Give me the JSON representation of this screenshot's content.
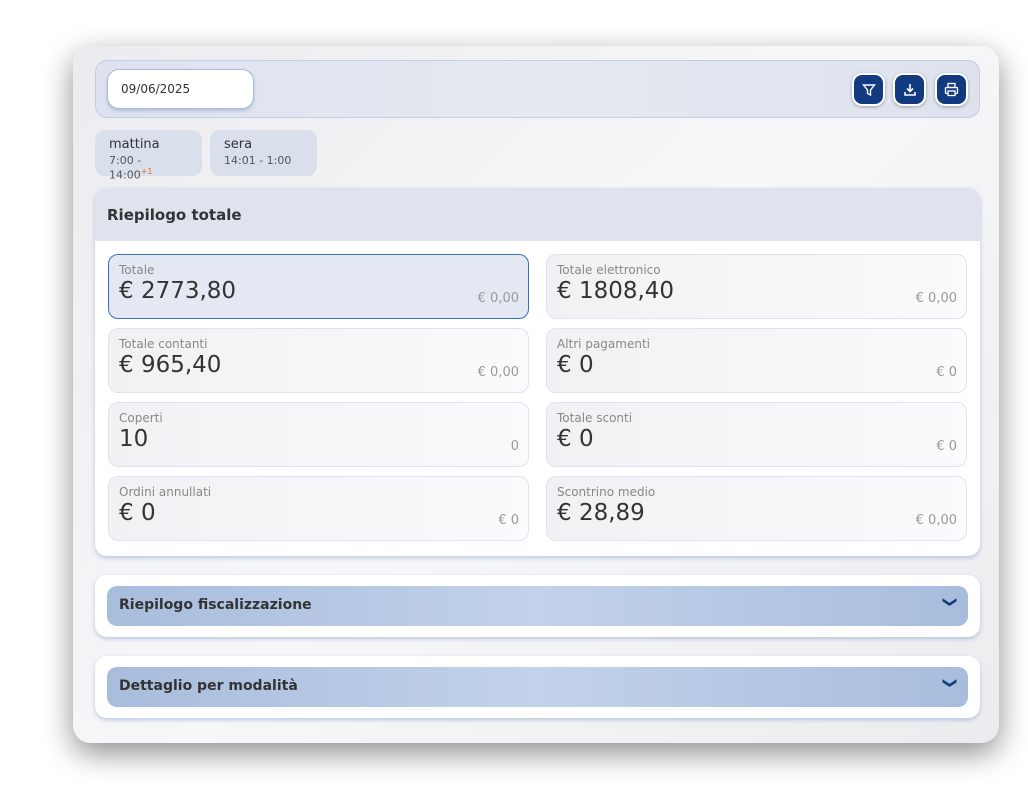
{
  "date": "09/06/2025",
  "toolbar": {
    "icons": [
      "filter-icon",
      "download-icon",
      "print-icon"
    ],
    "accent": "#123a80"
  },
  "shifts": [
    {
      "name": "mattina",
      "time": "7:00 - 14:00",
      "extra": "+1"
    },
    {
      "name": "sera",
      "time": "14:01 - 1:00"
    }
  ],
  "summary": {
    "title": "Riepilogo totale",
    "tiles": [
      {
        "label": "Totale",
        "value": "€ 2773,80",
        "sub": "€ 0,00"
      },
      {
        "label": "Totale elettronico",
        "value": "€ 1808,40",
        "sub": "€ 0,00"
      },
      {
        "label": "Totale contanti",
        "value": "€ 965,40",
        "sub": "€ 0,00"
      },
      {
        "label": "Altri pagamenti",
        "value": "€ 0",
        "sub": "€ 0"
      },
      {
        "label": "Coperti",
        "value": "10",
        "sub": "0"
      },
      {
        "label": "Totale sconti",
        "value": "€ 0",
        "sub": "€ 0"
      },
      {
        "label": "Ordini annullati",
        "value": "€ 0",
        "sub": "€ 0"
      },
      {
        "label": "Scontrino medio",
        "value": "€ 28,89",
        "sub": "€ 0,00"
      }
    ]
  },
  "sections": [
    {
      "label": "Riepilogo fiscalizzazione"
    },
    {
      "label": "Dettaglio per modalità"
    }
  ]
}
